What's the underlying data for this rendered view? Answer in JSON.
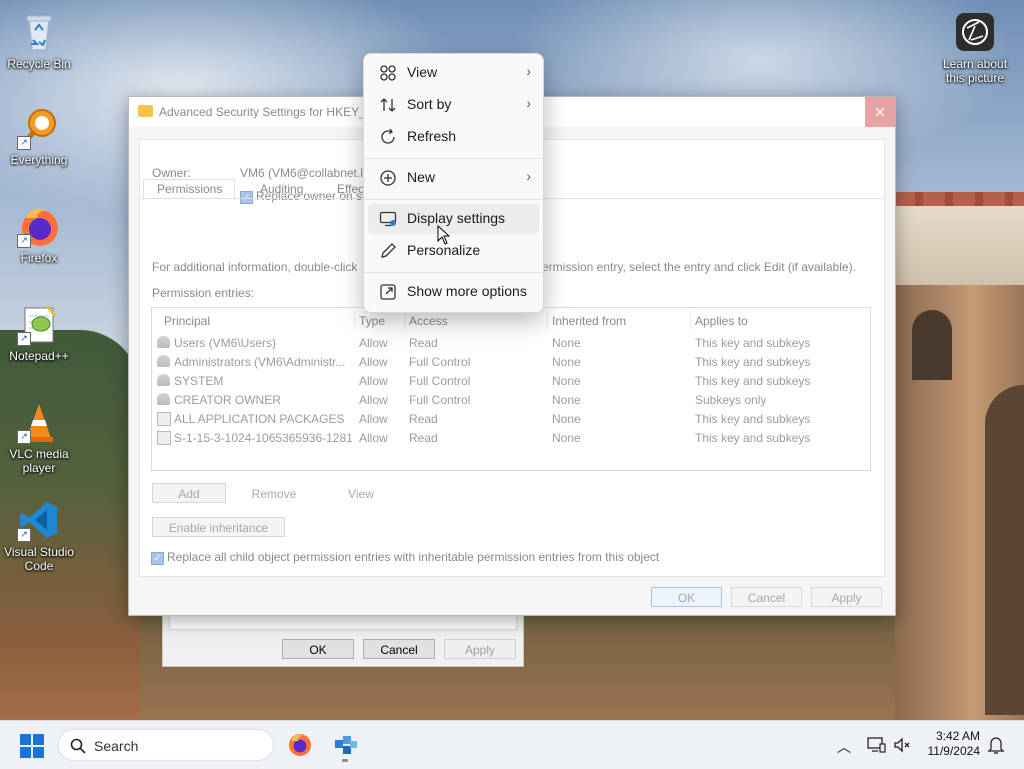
{
  "desktop": {
    "icons": [
      {
        "label": "Recycle Bin",
        "icon": "recycle-bin-icon"
      },
      {
        "label": "Everything",
        "icon": "everything-search-icon"
      },
      {
        "label": "Firefox",
        "icon": "firefox-icon"
      },
      {
        "label": "Notepad++",
        "icon": "notepad-plus-plus-icon"
      },
      {
        "label": "VLC media player",
        "icon": "vlc-icon"
      },
      {
        "label": "Visual Studio Code",
        "icon": "vscode-icon"
      }
    ],
    "learn_about": {
      "line1": "Learn about",
      "line2": "this picture",
      "icon": "camera-lens-icon"
    }
  },
  "back_dialog": {
    "ok": "OK",
    "cancel": "Cancel",
    "apply": "Apply"
  },
  "advanced_security": {
    "title": "Advanced Security Settings for HKEY_C",
    "owner_label": "Owner:",
    "owner_value": "VM6 (VM6@collabnet.l",
    "replace_owner": "Replace owner on su",
    "tabs": [
      "Permissions",
      "Auditing",
      "Effec"
    ],
    "info_left": "For additional information, double-click",
    "info_right": "ermission entry, select the entry and click Edit (if available).",
    "entries_label": "Permission entries:",
    "columns": [
      "Principal",
      "Type",
      "Access",
      "Inherited from",
      "Applies to"
    ],
    "rows": [
      {
        "principal": "Users (VM6\\Users)",
        "type": "Allow",
        "access": "Read",
        "inherited": "None",
        "applies": "This key and subkeys",
        "icon": "user-group-icon"
      },
      {
        "principal": "Administrators (VM6\\Administr...",
        "type": "Allow",
        "access": "Full Control",
        "inherited": "None",
        "applies": "This key and subkeys",
        "icon": "user-group-icon"
      },
      {
        "principal": "SYSTEM",
        "type": "Allow",
        "access": "Full Control",
        "inherited": "None",
        "applies": "This key and subkeys",
        "icon": "user-group-icon"
      },
      {
        "principal": "CREATOR OWNER",
        "type": "Allow",
        "access": "Full Control",
        "inherited": "None",
        "applies": "Subkeys only",
        "icon": "user-group-icon"
      },
      {
        "principal": "ALL APPLICATION PACKAGES",
        "type": "Allow",
        "access": "Read",
        "inherited": "None",
        "applies": "This key and subkeys",
        "icon": "package-icon"
      },
      {
        "principal": "S-1-15-3-1024-1065365936-1281...",
        "type": "Allow",
        "access": "Read",
        "inherited": "None",
        "applies": "This key and subkeys",
        "icon": "package-icon"
      }
    ],
    "add": "Add",
    "remove": "Remove",
    "view": "View",
    "enable_inheritance": "Enable inheritance",
    "replace_child": "Replace all child object permission entries with inheritable permission entries from this object",
    "ok": "OK",
    "cancel": "Cancel",
    "apply": "Apply"
  },
  "context_menu": {
    "items": [
      {
        "label": "View",
        "icon": "grid-view-icon",
        "submenu": "›"
      },
      {
        "label": "Sort by",
        "icon": "sort-icon",
        "submenu": "›"
      },
      {
        "label": "Refresh",
        "icon": "refresh-icon"
      },
      {
        "label": "New",
        "icon": "plus-circle-icon",
        "submenu": "›"
      },
      {
        "label": "Display settings",
        "icon": "display-settings-icon"
      },
      {
        "label": "Personalize",
        "icon": "pen-icon"
      },
      {
        "label": "Show more options",
        "icon": "share-options-icon"
      }
    ]
  },
  "taskbar": {
    "search_label": "Search",
    "time": "3:42 AM",
    "date": "11/9/2024"
  }
}
